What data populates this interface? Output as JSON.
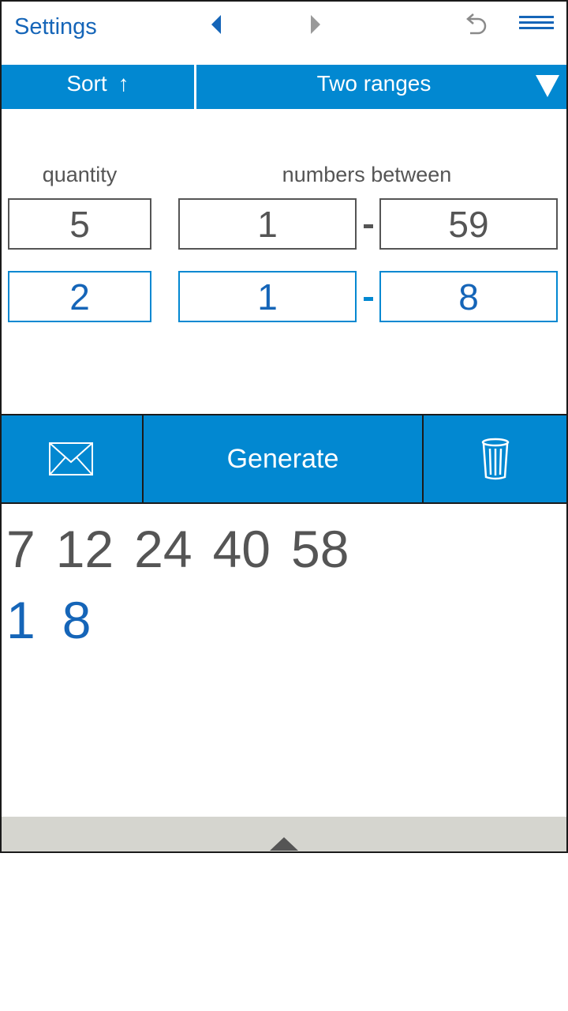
{
  "toolbar": {
    "settings_label": "Settings",
    "prev_icon": "triangle-left-icon",
    "next_icon": "triangle-right-icon",
    "undo_icon": "undo-icon",
    "menu_icon": "hamburger-menu-icon"
  },
  "bluebar": {
    "sort_label": "Sort",
    "sort_arrow": "↑",
    "mode_label": "Two ranges",
    "mode_icon": "dropdown-triangle-icon"
  },
  "form": {
    "quantity_label": "quantity",
    "range_label": "numbers between",
    "row1": {
      "quantity": "5",
      "from": "1",
      "to": "59"
    },
    "row2": {
      "quantity": "2",
      "from": "1",
      "to": "8"
    }
  },
  "actions": {
    "mail_icon": "envelope-icon",
    "generate_label": "Generate",
    "trash_icon": "trash-icon"
  },
  "results": {
    "row1": [
      "7",
      "12",
      "24",
      "40",
      "58"
    ],
    "row2": [
      "1",
      "8"
    ]
  },
  "colors": {
    "accent": "#0288d1",
    "link": "#1565b8",
    "text_gray": "#555555",
    "bottom_bar": "#d5d5cf"
  }
}
